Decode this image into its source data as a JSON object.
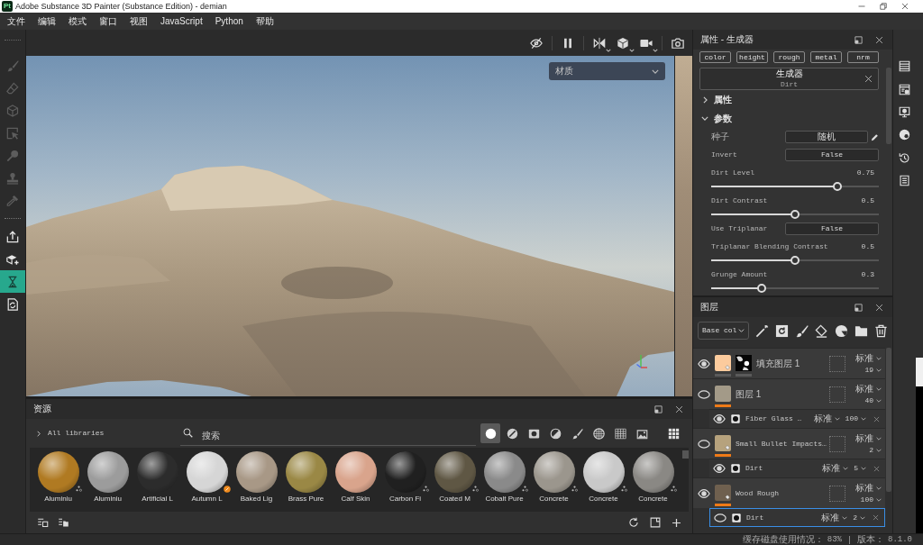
{
  "window": {
    "logo": "Pt",
    "title": "Adobe Substance 3D Painter (Substance Edition) - demian"
  },
  "menu": [
    "文件",
    "编辑",
    "模式",
    "窗口",
    "视图",
    "JavaScript",
    "Python",
    "帮助"
  ],
  "tool_groups": [
    [
      {
        "kind": "brush",
        "disabled": true,
        "selected": false
      },
      {
        "kind": "eraser",
        "disabled": true,
        "selected": false
      },
      {
        "kind": "projection",
        "disabled": true,
        "selected": false
      },
      {
        "kind": "polygon-fill",
        "disabled": true,
        "selected": false
      },
      {
        "kind": "smudge",
        "disabled": true,
        "selected": false
      },
      {
        "kind": "clone",
        "disabled": true,
        "selected": false
      },
      {
        "kind": "picker",
        "disabled": true,
        "selected": false
      }
    ],
    [
      {
        "kind": "export",
        "disabled": false,
        "selected": false
      },
      {
        "kind": "send-to",
        "disabled": false,
        "selected": false
      },
      {
        "kind": "bake",
        "disabled": false,
        "selected": true
      },
      {
        "kind": "texture-set",
        "disabled": false,
        "selected": false
      }
    ]
  ],
  "viewport": {
    "view_mode": "材质"
  },
  "properties": {
    "title": "属性 - 生成器",
    "channels": [
      "color",
      "height",
      "rough",
      "metal",
      "nrm"
    ],
    "generator": {
      "label": "生成器",
      "name": "Dirt"
    },
    "sections": [
      {
        "label": "属性",
        "expanded": false
      },
      {
        "label": "参数",
        "expanded": true,
        "params": [
          {
            "kind": "button",
            "label": "种子",
            "value": "随机"
          },
          {
            "kind": "dropdown",
            "label": "Invert",
            "value": "False"
          },
          {
            "kind": "slider",
            "label": "Dirt Level",
            "reading": "0.75",
            "level": 0.75
          },
          {
            "kind": "slider",
            "label": "Dirt Contrast",
            "reading": "0.5",
            "level": 0.5
          },
          {
            "kind": "dropdown",
            "label": "Use Triplanar",
            "value": "False"
          },
          {
            "kind": "slider",
            "label": "Triplanar Blending Contrast",
            "reading": "0.5",
            "level": 0.5
          },
          {
            "kind": "slider",
            "label": "Grunge Amount",
            "reading": "0.3",
            "level": 0.3
          }
        ]
      }
    ]
  },
  "layers": {
    "title": "图层",
    "channel": "Base col",
    "items": [
      {
        "kind": "fill",
        "name": "填充图层 1",
        "visible": true,
        "selected": false,
        "color": "#fccb9d",
        "mask": true,
        "content_active": false,
        "blend": "标准",
        "opacity": "19"
      },
      {
        "kind": "paint",
        "name": "图层 1",
        "visible": false,
        "selected": false,
        "color": "#a39a88",
        "mask": false,
        "content_active": true,
        "blend": "标准",
        "opacity": "40",
        "effects": [
          {
            "name": "Fiber Glass …",
            "visible": true,
            "selected": false,
            "blend": "标准",
            "opacity": "100"
          }
        ]
      },
      {
        "kind": "fill",
        "name": "Small Bullet Impacts…",
        "visible": false,
        "selected": false,
        "color": "#b6a27d",
        "mask": false,
        "content_active": true,
        "blend": "标准",
        "opacity": "2",
        "effects": [
          {
            "name": "Dirt",
            "visible": true,
            "selected": false,
            "blend": "标准",
            "opacity": "5"
          }
        ]
      },
      {
        "kind": "fill",
        "name": "Wood Rough",
        "visible": true,
        "selected": false,
        "color": "#6f604f",
        "mask": false,
        "content_active": true,
        "blend": "标准",
        "opacity": "100",
        "effects": [
          {
            "name": "Dirt",
            "visible": false,
            "selected": true,
            "blend": "标准",
            "opacity": "2"
          }
        ]
      }
    ]
  },
  "assets": {
    "title": "资源",
    "library": "All libraries",
    "search": {
      "placeholder": "搜索"
    },
    "filters": [
      {
        "kind": "materials",
        "selected": true
      },
      {
        "kind": "smart-materials",
        "selected": false
      },
      {
        "kind": "smart-masks",
        "selected": false
      },
      {
        "kind": "filters",
        "selected": false
      },
      {
        "kind": "brushes",
        "selected": false
      },
      {
        "kind": "procedurals",
        "selected": false
      },
      {
        "kind": "textures",
        "selected": false
      },
      {
        "kind": "environments",
        "selected": false
      }
    ],
    "items": [
      {
        "kind": "substance",
        "name": "Aluminiu",
        "color": "#b07a22"
      },
      {
        "kind": "plain",
        "name": "Aluminiu",
        "color": "#9c9c9c"
      },
      {
        "kind": "plain",
        "name": "Artificial L",
        "color": "#2c2c2c"
      },
      {
        "kind": "smart",
        "name": "Autumn L",
        "color": "#d6d6d6"
      },
      {
        "kind": "plain",
        "name": "Baked Lig",
        "color": "#a89886"
      },
      {
        "kind": "plain",
        "name": "Brass Pure",
        "color": "#9a8845"
      },
      {
        "kind": "plain",
        "name": "Calf Skin",
        "color": "#d9a48c"
      },
      {
        "kind": "substance",
        "name": "Carbon Fi",
        "color": "#202020"
      },
      {
        "kind": "substance",
        "name": "Coated M",
        "color": "#5f5744"
      },
      {
        "kind": "substance",
        "name": "Cobalt Pure",
        "color": "#8a8a8a"
      },
      {
        "kind": "substance",
        "name": "Concrete",
        "color": "#9b968d"
      },
      {
        "kind": "substance",
        "name": "Concrete",
        "color": "#c9c9c9"
      },
      {
        "kind": "substance",
        "name": "Concrete",
        "color": "#8a8884"
      }
    ]
  },
  "status_bar": [
    {
      "label": "缓存磁盘使用情况：",
      "value": "83%"
    },
    {
      "label": "版本：",
      "value": "8.1.0"
    }
  ]
}
